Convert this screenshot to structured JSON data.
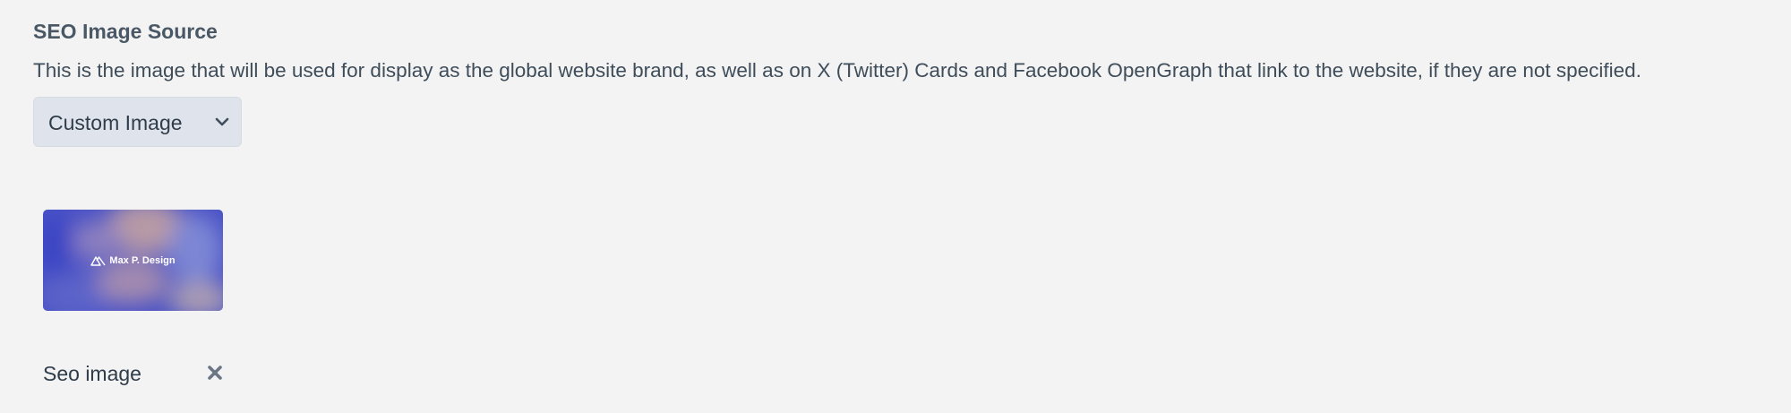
{
  "field": {
    "label": "SEO Image Source",
    "instructions": "This is the image that will be used for display as the global website brand, as well as on X (Twitter) Cards and Facebook OpenGraph that link to the website, if they are not specified.",
    "select": {
      "selected": "Custom Image",
      "icon": "chevron-down-icon"
    }
  },
  "asset": {
    "brand_text": "Max P. Design",
    "brand_icon": "mountain-logo-icon",
    "title": "Seo image",
    "remove_icon": "close-icon"
  },
  "colors": {
    "background": "#f3f3f3",
    "select_bg": "#dfe4ec",
    "text": "#3f4d5a",
    "remove_icon": "#6b7784"
  }
}
